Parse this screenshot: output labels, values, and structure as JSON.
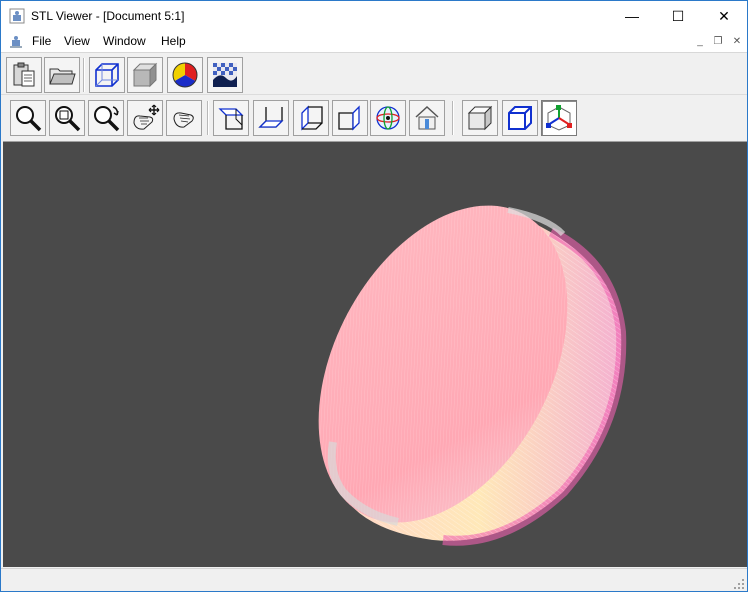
{
  "window": {
    "title": "STL Viewer - [Document 5:1]",
    "minimize_glyph": "—",
    "maximize_glyph": "☐",
    "close_glyph": "✕"
  },
  "menu": {
    "items": [
      "File",
      "View",
      "Window",
      "Help"
    ],
    "mdi_minimize": "_",
    "mdi_restore": "❐",
    "mdi_close": "✕"
  },
  "toolbar_main": {
    "buttons": [
      {
        "icon": "paste-icon"
      },
      {
        "icon": "open-folder-icon"
      },
      {
        "icon": "wireframe-cube-icon"
      },
      {
        "icon": "solid-cube-icon"
      },
      {
        "icon": "color-wheel-icon"
      },
      {
        "icon": "texture-icon"
      }
    ]
  },
  "toolbar_view": {
    "buttons": [
      {
        "icon": "zoom-icon"
      },
      {
        "icon": "zoom-window-icon"
      },
      {
        "icon": "zoom-rotate-icon"
      },
      {
        "icon": "pan-hand-icon"
      },
      {
        "icon": "rotate-hand-icon"
      },
      {
        "icon": "view-front-icon"
      },
      {
        "icon": "view-top-icon"
      },
      {
        "icon": "view-side-icon"
      },
      {
        "icon": "view-right-icon"
      },
      {
        "icon": "view-iso-icon"
      },
      {
        "icon": "home-view-icon"
      },
      {
        "icon": "shaded-mode-icon"
      },
      {
        "icon": "wire-mode-icon"
      },
      {
        "icon": "axes-mode-icon"
      }
    ],
    "pressed_index": 13
  },
  "colors": {
    "viewport_bg": "#4a4a4a",
    "model_face": "#ffb0b8",
    "model_rim_warm": "#ffe8b8",
    "model_rim_edge": "#f060b0",
    "model_shadow": "#c8c8c8"
  },
  "status": {
    "text": ""
  }
}
